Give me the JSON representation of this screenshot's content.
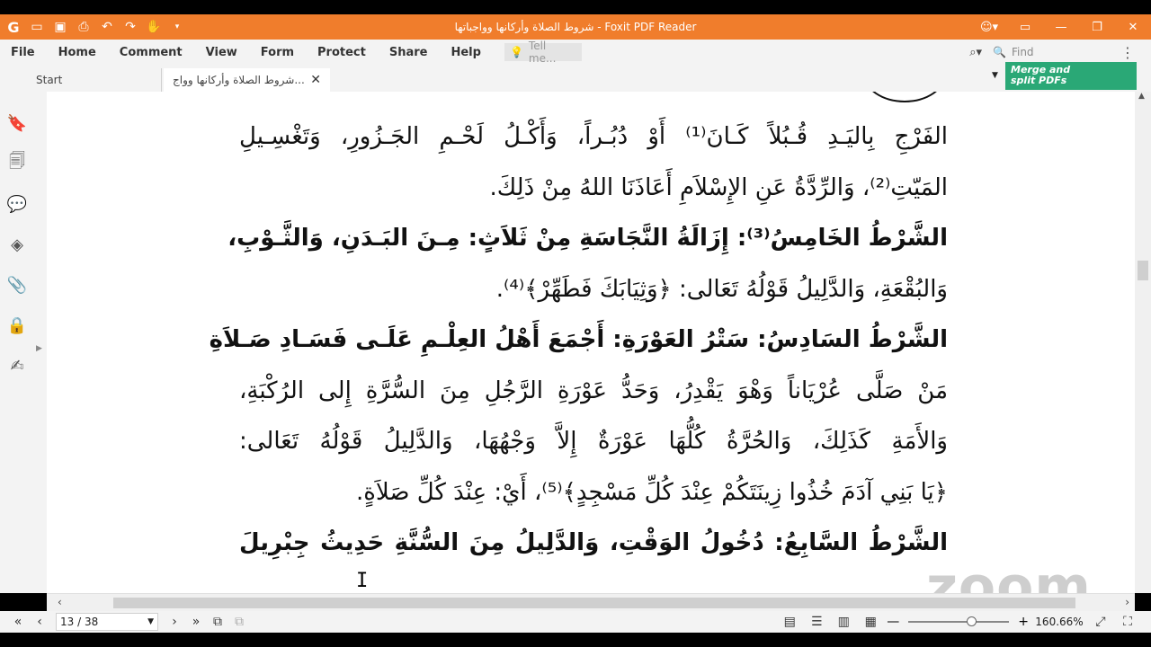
{
  "window": {
    "title": "شروط الصلاة وأركانها وواجباتها - Foxit PDF Reader",
    "app_icon": "foxit-logo-icon",
    "quick_access_icons": [
      "open-folder-icon",
      "save-icon",
      "print-icon",
      "undo-icon",
      "redo-icon",
      "hand-tool-icon",
      "customize-icon"
    ],
    "accent_color": "#f07d2c"
  },
  "menu": {
    "items": [
      "File",
      "Home",
      "Comment",
      "View",
      "Form",
      "Protect",
      "Share",
      "Help"
    ],
    "tell_me_placeholder": "Tell me...",
    "find_placeholder": "Find"
  },
  "tabs": {
    "start_label": "Start",
    "doc_label": "شروط الصلاة وأركانها وواج..."
  },
  "ad": {
    "line1": "Merge and",
    "line2": "split PDFs",
    "color": "#2aa876"
  },
  "sidebar": {
    "icons": [
      "bookmark-icon",
      "pages-icon",
      "comments-icon",
      "layers-icon",
      "attachment-icon",
      "security-icon",
      "signature-icon"
    ]
  },
  "document": {
    "lines": [
      "الفَرْجِ بِاليَـدِ قُـبُلاً كَـانَ⁽¹⁾ أَوْ دُبُـراً، وَأَكْـلُ لَحْـمِ الجَـزُورِ، وَتَغْسِـيلِ",
      "المَيّتِ⁽²⁾، وَالرِّدَّةُ عَنِ الإِسْلاَمِ أَعَاذَنَا اللهُ مِنْ ذَلِكَ.",
      "الشَّرْطُ الخَامِسُ⁽³⁾: إِزَالَةُ النَّجَاسَةِ مِنْ ثَلاَثٍ: مِـنَ البَـدَنِ، وَالثَّـوْبِ،",
      "وَالبُقْعَةِ، وَالدَّلِيلُ قَوْلُهُ تَعَالى: ﴿وَثِيَابَكَ فَطَهِّرْ﴾⁽⁴⁾.",
      "الشَّرْطُ السَادِسُ: سَتْرُ العَوْرَةِ: أَجْمَعَ أَهْلُ العِلْـمِ عَلَـى فَسَـادِ صَـلاَةِ",
      "مَنْ صَلَّى عُرْيَاناً وَهْوَ يَقْدِرُ، وَحَدُّ عَوْرَةِ الرَّجُلِ مِنَ السُّرَّةِ إِلى الرُكْبَةِ،",
      "وَالأَمَةِ كَذَلِكَ، وَالحُرَّةُ كُلُّهَا عَوْرَةٌ إِلاَّ وَجْهُهَا، وَالدَّلِيلُ قَوْلُهُ تَعَالى:",
      "﴿يَا بَنِي آدَمَ خُذُوا زِينَتَكُمْ عِنْدَ كُلِّ مَسْجِدٍ﴾⁽⁵⁾، أَيْ: عِنْدَ كُلِّ صَلاَةٍ.",
      "الشَّرْطُ السَّابِعُ: دُخُولُ الوَقْتِ، وَالدَّلِيلُ مِنَ السُّنَّةِ حَدِيثُ جِبْرِيلَ"
    ],
    "watermark": "zoom"
  },
  "status": {
    "page_display": "13 / 38",
    "zoom_level": "160.66%",
    "zoom_fraction": 0.62
  }
}
